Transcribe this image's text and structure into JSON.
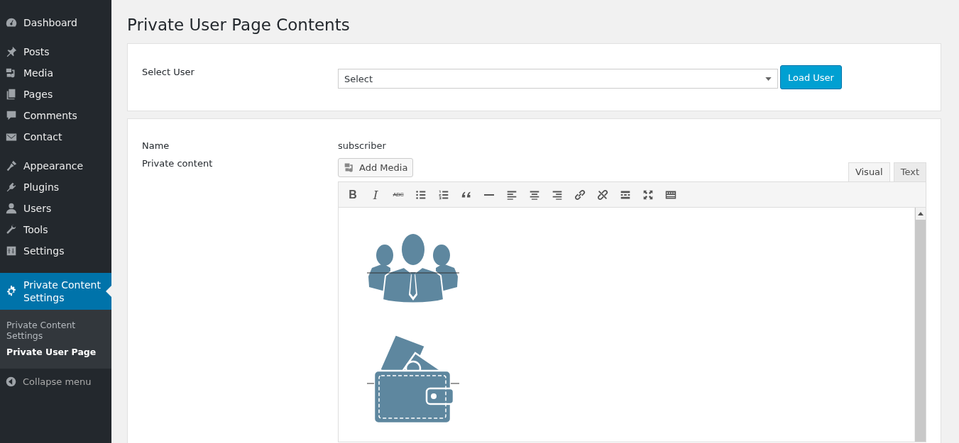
{
  "sidebar": {
    "items": [
      {
        "label": "Dashboard",
        "selected": false
      },
      {
        "label": "Posts",
        "selected": false
      },
      {
        "label": "Media",
        "selected": false
      },
      {
        "label": "Pages",
        "selected": false
      },
      {
        "label": "Comments",
        "selected": false
      },
      {
        "label": "Contact",
        "selected": false
      },
      {
        "label": "Appearance",
        "selected": false
      },
      {
        "label": "Plugins",
        "selected": false
      },
      {
        "label": "Users",
        "selected": false
      },
      {
        "label": "Tools",
        "selected": false
      },
      {
        "label": "Settings",
        "selected": false
      },
      {
        "label": "Private Content Settings",
        "selected": true
      }
    ],
    "submenu": [
      {
        "label": "Private Content Settings",
        "selected": false
      },
      {
        "label": "Private User Page",
        "selected": true
      }
    ],
    "collapse": "Collapse menu"
  },
  "page_title": "Private User Page Contents",
  "select_user": {
    "label": "Select User",
    "value": "Select",
    "button": "Load User"
  },
  "form": {
    "name_label": "Name",
    "name_value": "subscriber",
    "content_label": "Private content",
    "add_media": "Add Media",
    "tabs": [
      {
        "label": "Visual",
        "selected": true
      },
      {
        "label": "Text",
        "selected": false
      }
    ],
    "toolbar": [
      {
        "kind": "bold",
        "label": "B"
      },
      {
        "kind": "italic",
        "label": "I"
      },
      {
        "kind": "strike",
        "label": "ABC"
      },
      {
        "kind": "bullets"
      },
      {
        "kind": "numbers"
      },
      {
        "kind": "quote"
      },
      {
        "kind": "hr"
      },
      {
        "kind": "align-left"
      },
      {
        "kind": "align-center"
      },
      {
        "kind": "align-right"
      },
      {
        "kind": "link"
      },
      {
        "kind": "unlink"
      },
      {
        "kind": "more"
      },
      {
        "kind": "fullscreen"
      },
      {
        "kind": "kitchen"
      }
    ],
    "content": [
      {
        "kind": "people"
      },
      {
        "kind": "wallet"
      }
    ]
  }
}
